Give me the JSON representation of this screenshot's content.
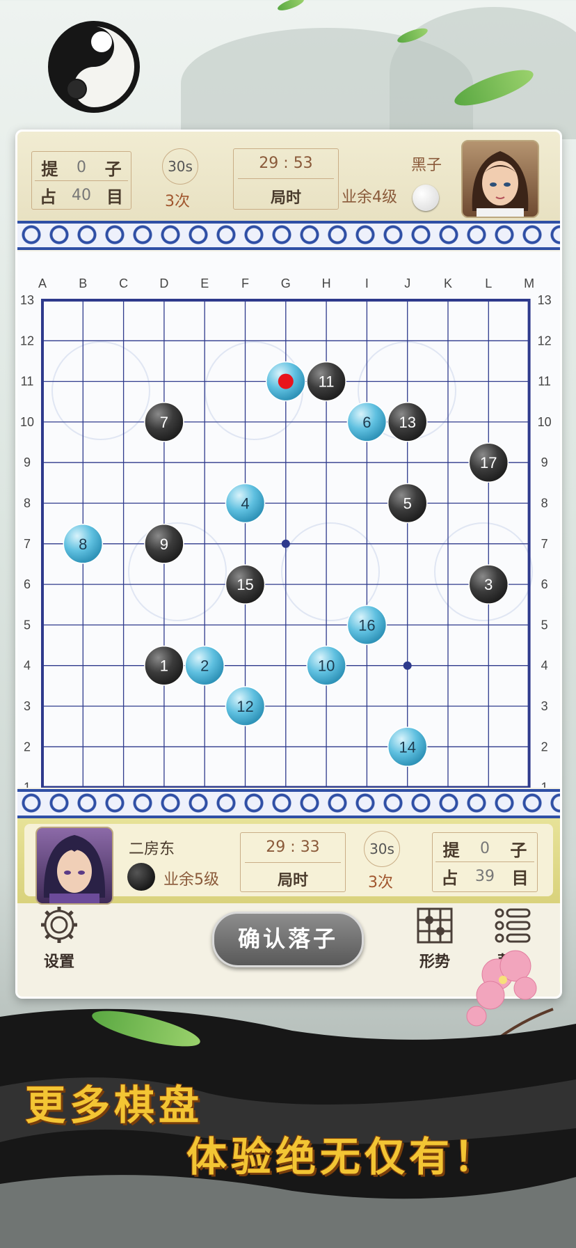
{
  "top_player": {
    "capture_label": "提",
    "capture_count": "0",
    "capture_unit": "子",
    "territory_label": "占",
    "territory_count": "40",
    "territory_unit": "目",
    "byo_time": "30s",
    "byo_count": "3次",
    "main_time": "29 : 53",
    "main_time_label": "局时",
    "color_label": "黑子",
    "level": "业余4级"
  },
  "bottom_player": {
    "name": "二房东",
    "level": "业余5级",
    "main_time": "29 : 33",
    "main_time_label": "局时",
    "byo_time": "30s",
    "byo_count": "3次",
    "capture_label": "提",
    "capture_count": "0",
    "capture_unit": "子",
    "territory_label": "占",
    "territory_count": "39",
    "territory_unit": "目"
  },
  "board": {
    "size": 13,
    "columns": [
      "A",
      "B",
      "C",
      "D",
      "E",
      "F",
      "G",
      "H",
      "I",
      "J",
      "K",
      "L",
      "M"
    ],
    "rows": [
      "13",
      "12",
      "11",
      "10",
      "9",
      "8",
      "7",
      "6",
      "5",
      "4",
      "3",
      "2",
      "1"
    ],
    "star_points": [
      "G7",
      "J4"
    ],
    "stones": [
      {
        "label": "1",
        "color": "black",
        "pos": "D4"
      },
      {
        "label": "2",
        "color": "white",
        "pos": "E4"
      },
      {
        "label": "3",
        "color": "black",
        "pos": "L6"
      },
      {
        "label": "4",
        "color": "white",
        "pos": "F8"
      },
      {
        "label": "5",
        "color": "black",
        "pos": "J8"
      },
      {
        "label": "6",
        "color": "white",
        "pos": "I10"
      },
      {
        "label": "7",
        "color": "black",
        "pos": "D10"
      },
      {
        "label": "8",
        "color": "white",
        "pos": "B7"
      },
      {
        "label": "9",
        "color": "black",
        "pos": "D7"
      },
      {
        "label": "10",
        "color": "white",
        "pos": "H4"
      },
      {
        "label": "11",
        "color": "black",
        "pos": "H11"
      },
      {
        "label": "12",
        "color": "white",
        "pos": "F3"
      },
      {
        "label": "13",
        "color": "black",
        "pos": "J10"
      },
      {
        "label": "14",
        "color": "white",
        "pos": "J2"
      },
      {
        "label": "15",
        "color": "black",
        "pos": "F6"
      },
      {
        "label": "16",
        "color": "white",
        "pos": "I5"
      },
      {
        "label": "17",
        "color": "black",
        "pos": "L9"
      },
      {
        "label": "",
        "color": "white",
        "pos": "G11",
        "last_move": true
      }
    ]
  },
  "toolbar": {
    "settings_label": "设置",
    "confirm_label": "确认落子",
    "situation_label": "形势",
    "menu_label": "菜单"
  },
  "slogan": {
    "line1": "更多棋盘",
    "line2": "体验绝无仅有！"
  },
  "colors": {
    "board_line": "#2e3a8c",
    "black_stone": "#3b3b3b",
    "white_stone": "#5fc0e0",
    "last_move": "#e8141c",
    "slogan": "#f3c534"
  }
}
